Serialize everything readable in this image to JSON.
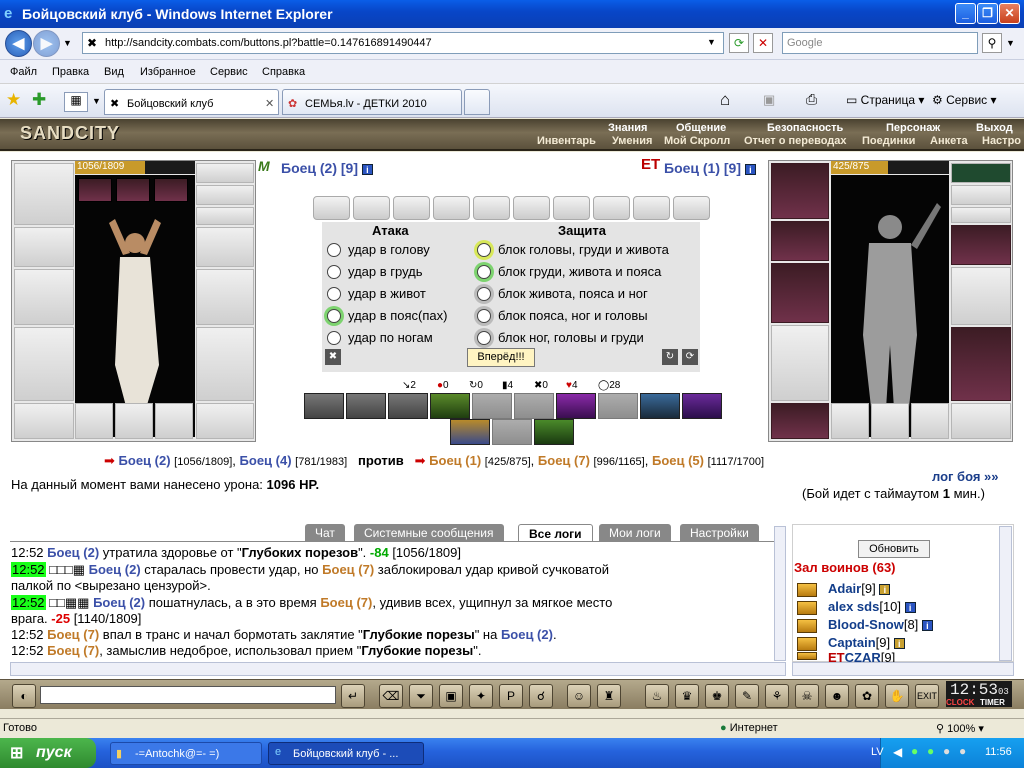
{
  "window": {
    "title": "Бойцовский клуб - Windows Internet Explorer"
  },
  "nav": {
    "url": "http://sandcity.combats.com/buttons.pl?battle=0.147616891490447",
    "search_placeholder": "Google"
  },
  "menu": [
    "Файл",
    "Правка",
    "Вид",
    "Избранное",
    "Сервис",
    "Справка"
  ],
  "tabs": [
    {
      "label": "Бойцовский клуб"
    },
    {
      "label": "СЕМЬя.lv - ДЕТКИ 2010"
    }
  ],
  "toolbar_right": {
    "page": "Страница",
    "service": "Сервис"
  },
  "game": {
    "logo": "SANDCITY",
    "top_menu": [
      "Знания",
      "Общение",
      "Безопасность",
      "Персонаж",
      "Выход"
    ],
    "sub_menu": [
      "Инвентарь",
      "Умения",
      "Мой Скролл",
      "Отчет о переводах",
      "Поединки",
      "Анкета",
      "Настро"
    ],
    "player": {
      "name": "Боец (2) [9]",
      "hp": "1056/1809",
      "hp_fraction": 0.584
    },
    "enemy": {
      "name": "Боец (1) [9]",
      "hp": "425/875",
      "hp_fraction": 0.486
    },
    "attack": {
      "header": "Атака",
      "options": [
        "удар в голову",
        "удар в грудь",
        "удар в живот",
        "удар в пояс(пах)",
        "удар по ногам"
      ],
      "selected": 3
    },
    "defense": {
      "header": "Защита",
      "options": [
        "блок головы, груди и живота",
        "блок груди, живота и пояса",
        "блок живота, пояса и ног",
        "блок пояса, ног и головы",
        "блок ног, головы и груди"
      ],
      "selected": 1
    },
    "go_button": "Вперёд!!!",
    "stats": [
      "2",
      "0",
      "0",
      "4",
      "0",
      "4",
      "28"
    ],
    "versus": {
      "team1": [
        {
          "name": "Боец (2)",
          "hp": "[1056/1809]"
        },
        {
          "name": "Боец (4)",
          "hp": "[781/1983]"
        }
      ],
      "word": "против",
      "team2": [
        {
          "name": "Боец (1)",
          "hp": "[425/875]"
        },
        {
          "name": "Боец (7)",
          "hp": "[996/1165]"
        },
        {
          "name": "Боец (5)",
          "hp": "[1117/1700]"
        }
      ]
    },
    "damage_text": "На данный момент вами нанесено урона:",
    "damage_value": "1096 HP.",
    "log_link": "лог боя »»",
    "timeout_text": "(Бой идет с таймаутом",
    "timeout_value": "1",
    "timeout_unit": "мин.)"
  },
  "log_tabs": [
    "Чат",
    "Системные сообщения",
    "Все логи",
    "Мои логи",
    "Настройки"
  ],
  "log": [
    {
      "time": "12:52",
      "who": "Боец (2)",
      "text1": " утратила здоровье от \"",
      "bold": "Глубоких порезов",
      "text2": "\". ",
      "num": "-84",
      "tail": " [1056/1809]"
    },
    {
      "time": "12:52",
      "who": "Боец (2)",
      "text1": " старалась провести удар, но ",
      "who2": "Боец (7)",
      "text2": " заблокировал удар кривой сучковатой",
      "line2": "палкой по <вырезано цензурой>."
    },
    {
      "time": "12:52",
      "who": "Боец (2)",
      "text1": " пошатнулась, а в это время ",
      "who2": "Боец (7)",
      "text2": ", удивив всех, ущипнул за мягкое место",
      "line2a": "врага. ",
      "num": "-25",
      "tail": " [1140/1809]"
    },
    {
      "time": "12:52",
      "who": "Боец (7)",
      "text1": " впал в транс и начал бормотать заклятие \"",
      "bold": "Глубокие порезы",
      "text2": "\" на ",
      "who2": "Боец (2)",
      "tail": "."
    },
    {
      "time": "12:52",
      "who": "Боец (7)",
      "text1": ", замыслив недоброе, использовал прием \"",
      "bold": "Глубокие порезы",
      "tail": "\"."
    }
  ],
  "hall": {
    "refresh": "Обновить",
    "title": "Зал воинов (63)",
    "warriors": [
      {
        "name": "Adair",
        "level": "[9]"
      },
      {
        "name": "alex sds",
        "level": "[10]"
      },
      {
        "name": "Blood-Snow",
        "level": "[8]"
      },
      {
        "name": "Captain",
        "level": "[9]"
      },
      {
        "name": "CZAR",
        "level": "[9]"
      }
    ]
  },
  "clock": {
    "time": "12:53",
    "sec": "03",
    "clock_label": "CLOCK",
    "timer_label": "TIMER"
  },
  "status": {
    "ready": "Готово",
    "zone": "Интернет",
    "zoom": "100%"
  },
  "taskbar": {
    "start": "пуск",
    "items": [
      "-=Antochk@=- =)",
      "Бойцовский клуб - ..."
    ],
    "lang": "LV",
    "time": "11:56"
  }
}
